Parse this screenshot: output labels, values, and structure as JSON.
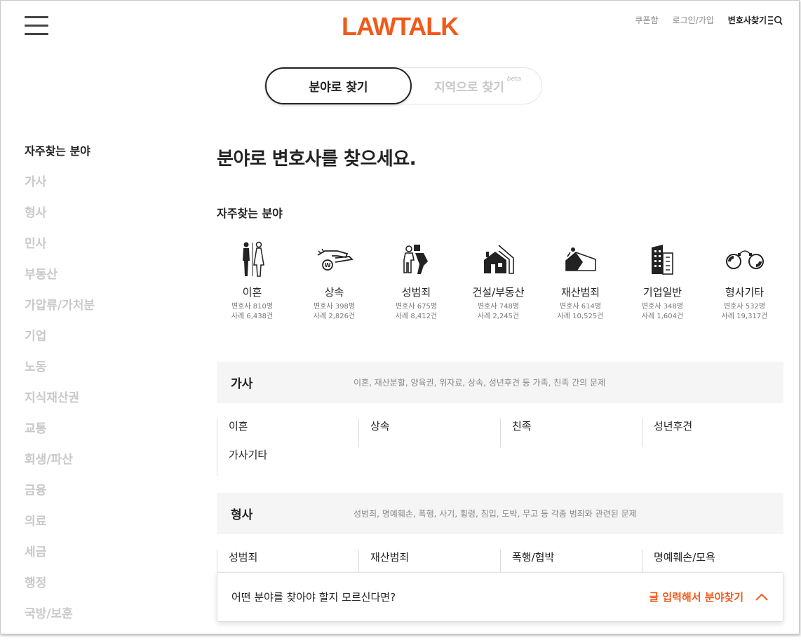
{
  "header": {
    "logo": "LAWTALK",
    "links": [
      "쿠폰함",
      "로그인/가입"
    ],
    "find_lawyer": "변호사찾기"
  },
  "toggle": {
    "active": "분야로 찾기",
    "inactive": "지역으로 찾기",
    "beta": "beta"
  },
  "sidebar": {
    "items": [
      "자주찾는 분야",
      "가사",
      "형사",
      "민사",
      "부동산",
      "가압류/가처분",
      "기업",
      "노동",
      "지식재산권",
      "교통",
      "회생/파산",
      "금융",
      "의료",
      "세금",
      "행정",
      "국방/보훈"
    ]
  },
  "main": {
    "title": "분야로 변호사를 찾으세요.",
    "frequent_title": "자주찾는 분야",
    "frequent": [
      {
        "name": "이혼",
        "lawyers": "변호사 810명",
        "cases": "사례 6,438건",
        "icon": "divorce-icon"
      },
      {
        "name": "상속",
        "lawyers": "변호사 398명",
        "cases": "사례 2,826건",
        "icon": "inheritance-icon"
      },
      {
        "name": "성범죄",
        "lawyers": "변호사 675명",
        "cases": "사례 8,412건",
        "icon": "sex-crime-icon"
      },
      {
        "name": "건설/부동산",
        "lawyers": "변호사 748명",
        "cases": "사례 2,245건",
        "icon": "house-icon"
      },
      {
        "name": "재산범죄",
        "lawyers": "변호사 614명",
        "cases": "사례 10,525건",
        "icon": "property-crime-icon"
      },
      {
        "name": "기업일반",
        "lawyers": "변호사 348명",
        "cases": "사례 1,604건",
        "icon": "building-icon"
      },
      {
        "name": "형사기타",
        "lawyers": "변호사 532명",
        "cases": "사례 19,317건",
        "icon": "handcuffs-icon"
      }
    ],
    "sections": [
      {
        "title": "가사",
        "desc": "이혼, 재산분할, 양육권, 위자료, 상속, 성년후견 등 가족, 친족 간의 문제",
        "subs": [
          "이혼",
          "상속",
          "친족",
          "성년후견",
          "가사기타"
        ]
      },
      {
        "title": "형사",
        "desc": "성범죄, 명예훼손, 폭행, 사기, 횡령, 침입, 도박, 무고 등 각종 범죄와 관련된 문제",
        "subs": [
          "성범죄",
          "재산범죄",
          "폭행/협박",
          "명예훼손/모욕"
        ]
      }
    ]
  },
  "bottom_bar": {
    "question": "어떤 분야를 찾아야 할지 모르신다면?",
    "cta": "글 입력해서 분야찾기"
  },
  "colors": {
    "accent": "#f05a1a",
    "text": "#222222",
    "muted": "#c9c9c9"
  }
}
